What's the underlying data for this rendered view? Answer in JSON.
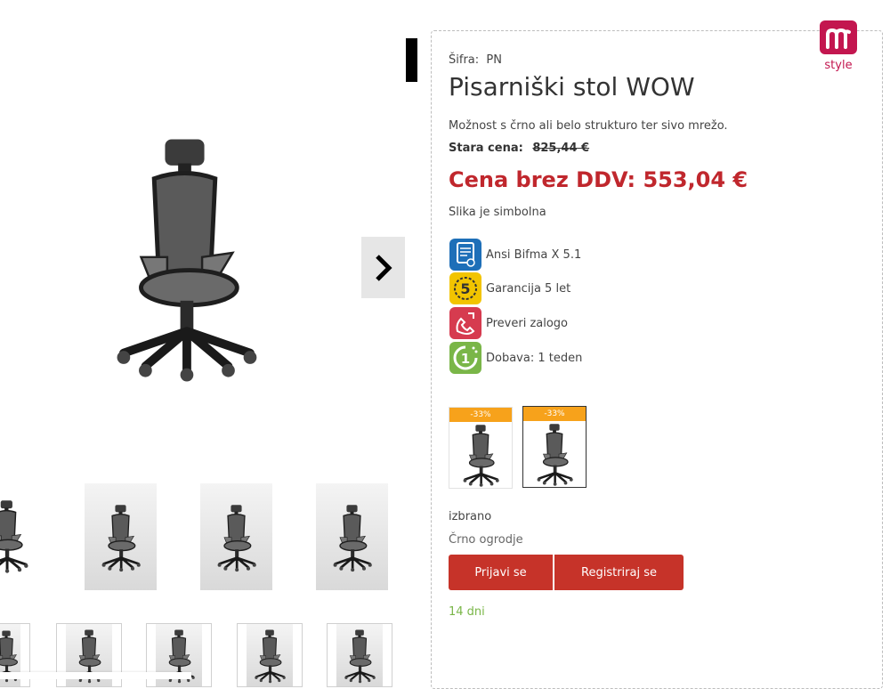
{
  "product": {
    "sku_label": "Šifra:",
    "sku_value": "PN",
    "title": "Pisarniški stol WOW",
    "description": "Možnost s črno ali belo strukturo ter sivo mrežo.",
    "old_price_label": "Stara cena:",
    "old_price_value": "825,44 €",
    "price": "Cena brez DDV: 553,04 €",
    "image_note": "Slika je simbolna"
  },
  "brand": {
    "logo_text": "style"
  },
  "features": [
    {
      "icon": "certificate-icon",
      "label": "Ansi Bifma X 5.1",
      "color": "#1e6fb8"
    },
    {
      "icon": "warranty-5-icon",
      "label": "Garancija 5 let",
      "color": "#f2c400"
    },
    {
      "icon": "phone-icon",
      "label": "Preveri zalogo",
      "color": "#d63b4f"
    },
    {
      "icon": "delivery-1-icon",
      "label": "Dobava: 1 teden",
      "color": "#7ab648"
    }
  ],
  "variants": [
    {
      "badge": "-33%",
      "frame": "white"
    },
    {
      "badge": "-33%",
      "frame": "black"
    }
  ],
  "selection": {
    "selected_label": "izbrano",
    "selected_value": "Črno ogrodje"
  },
  "buttons": {
    "login": "Prijavi se",
    "register": "Registriraj se"
  },
  "delivery_days": "14 dni",
  "colors": {
    "accent_red": "#c0272d",
    "button_red": "#c63329",
    "badge_orange": "#f7a21b",
    "delivery_green": "#7ab648",
    "logo_magenta": "#c3164f"
  }
}
